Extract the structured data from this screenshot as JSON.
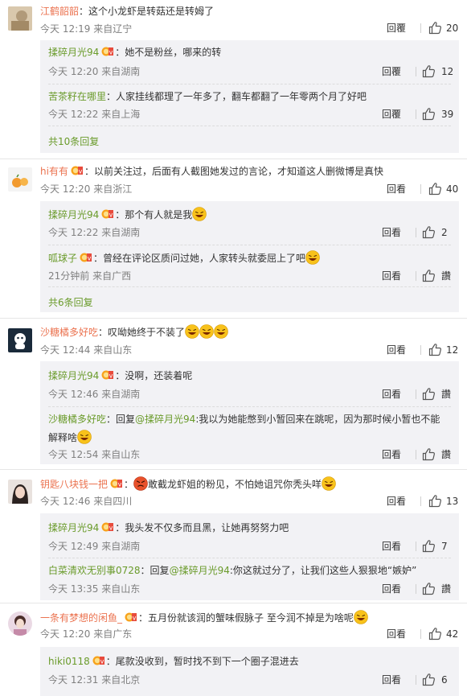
{
  "colors": {
    "username": "#eb7350",
    "sub_username": "#6a9b2b",
    "meta": "#808080",
    "reply_bg": "#f2f2f5"
  },
  "comments": [
    {
      "user": "江鹤韶韶",
      "text": "：这个小龙虾是转菇还是转姆了",
      "time": "今天 12:19 来自辽宁",
      "reply": "回覆",
      "likes": "20",
      "replies": [
        {
          "user": "揉碎月光94",
          "text": "：她不是粉丝，哪来的转",
          "time": "今天 12:20 来自湖南",
          "reply": "回覆",
          "likes": "12"
        },
        {
          "user": "苦茶籽在哪里",
          "text": "：人家挂线都理了一年多了，翻车都翻了一年零两个月了好吧",
          "time": "今天 12:22 来自上海",
          "reply": "回覆",
          "likes": "39"
        }
      ],
      "more": "共10条回复"
    },
    {
      "user": "hi有有",
      "text": "：以前关注过，后面有人截图她发过的言论，才知道这人删微博是真快",
      "time": "今天 12:20 来自浙江",
      "reply": "回看",
      "likes": "40",
      "replies": [
        {
          "user": "揉碎月光94",
          "text": "：那个有人就是我",
          "time": "今天 12:22 来自湖南",
          "reply": "回看",
          "likes": "2"
        },
        {
          "user": "呱球子",
          "text": "：曾经在评论区质问过她，人家转头就委屈上了吧",
          "time": "21分钟前 来自广西",
          "reply": "回看",
          "likes": "讚"
        }
      ],
      "more": "共6条回复"
    },
    {
      "user": "沙糖橘多好吃",
      "text": "：叹呦她终于不装了",
      "time": "今天 12:44 来自山东",
      "reply": "回看",
      "likes": "12",
      "replies": [
        {
          "user": "揉碎月光94",
          "text": "：没啊，还装着呢",
          "time": "今天 12:46 来自湖南",
          "reply": "回看",
          "likes": "讚"
        },
        {
          "user": "沙糖橘多好吃",
          "text_pre": "：回复",
          "at": "@揉碎月光94",
          "text_post": ":我以为她能憋到小暂回来在跳呢，因为那时候小暂也不能",
          "text2": "解释啥",
          "time": "今天 12:54 来自山东",
          "reply": "回看",
          "likes": "讚"
        }
      ]
    },
    {
      "user": "钥匙八块钱一把",
      "text_pre": "：",
      "text": "敢截龙虾姐的粉见，不怕她诅咒你秃头咩",
      "time": "今天 12:46 来自四川",
      "reply": "回看",
      "likes": "13",
      "replies": [
        {
          "user": "揉碎月光94",
          "text": "：我头发不仅多而且黑，让她再努努力吧",
          "time": "今天 12:49 来自湖南",
          "reply": "回看",
          "likes": "7"
        },
        {
          "user": "白菜清欢无别事0728",
          "text_pre": "：回复",
          "at": "@揉碎月光94",
          "text_post": ":你这就过分了，让我们这些人狠狠地“嫉妒”",
          "time": "今天 13:35 来自山东",
          "reply": "回看",
          "likes": "讚"
        }
      ]
    },
    {
      "user": "一条有梦想的闲鱼_",
      "text": "：五月份就该润的蟹味假脉子 至今润不掉是为啥呢",
      "time": "今天 12:20 来自广东",
      "reply": "回看",
      "likes": "42",
      "replies": [
        {
          "user": "hiki0118",
          "text": "：尾款没收到，暂时找不到下一个圈子混进去",
          "time": "今天 12:31 来自北京",
          "reply": "回看",
          "likes": "6"
        }
      ]
    }
  ]
}
